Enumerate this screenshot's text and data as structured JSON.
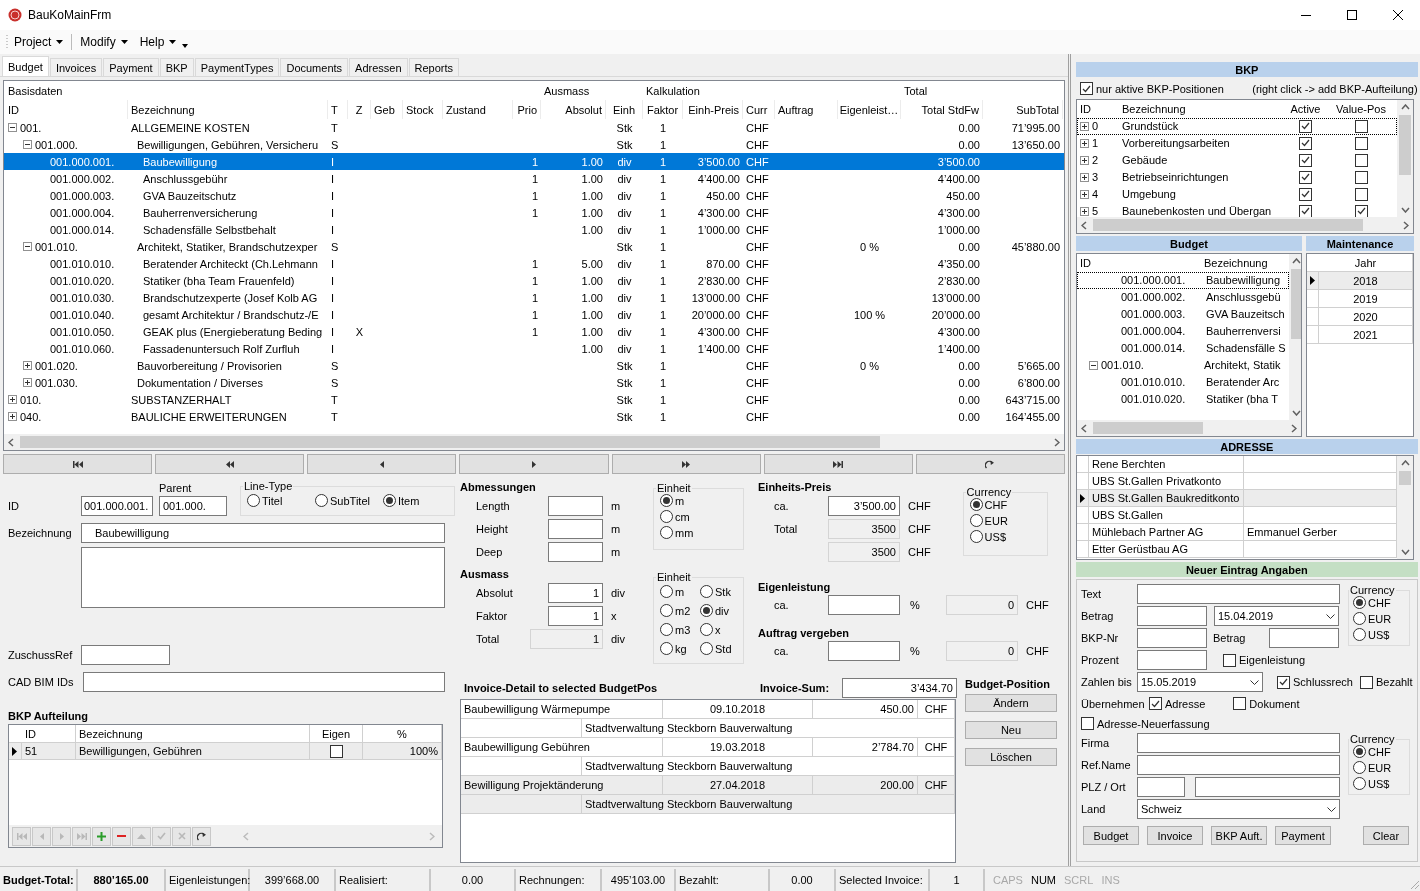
{
  "window": {
    "title": "BauKoMainFrm"
  },
  "menu": [
    {
      "label": "Project"
    },
    {
      "label": "Modify"
    },
    {
      "label": "Help"
    }
  ],
  "tabs": [
    {
      "label": "Budget",
      "selected": true
    },
    {
      "label": "Invoices",
      "selected": false
    },
    {
      "label": "Payment",
      "selected": false
    },
    {
      "label": "BKP",
      "selected": false
    },
    {
      "label": "PaymentTypes",
      "selected": false
    },
    {
      "label": "Documents",
      "selected": false
    },
    {
      "label": "Adressen",
      "selected": false
    },
    {
      "label": "Reports",
      "selected": false
    }
  ],
  "budget_grid": {
    "groups": [
      "Basisdaten",
      "Ausmass",
      "Kalkulation",
      "Total"
    ],
    "columns": [
      "ID",
      "Bezeichnung",
      "T",
      "Z",
      "Geb",
      "Stock",
      "Zustand",
      "Prio",
      "Absolut",
      "Einh",
      "Faktor",
      "Einh-Preis",
      "Curr",
      "Auftrag",
      "Eigenleist…",
      "Total StdFw",
      "SubTotal"
    ],
    "rows": [
      {
        "id": "001.",
        "bezeichnung": "ALLGEMEINE KOSTEN",
        "t": "T",
        "einh": "Stk",
        "faktor": "1",
        "curr": "CHF",
        "total_stdfw": "0.00",
        "subtotal": "71’995.00",
        "expanded": true,
        "selected": false,
        "children": [
          {
            "id": "001.000.",
            "bezeichnung": "Bewilligungen, Gebühren, Versicheru",
            "t": "S",
            "einh": "Stk",
            "faktor": "1",
            "curr": "CHF",
            "total_stdfw": "0.00",
            "subtotal": "13’650.00",
            "expanded": true,
            "selected": false,
            "children": [
              {
                "id": "001.000.001.",
                "bezeichnung": "Baubewilligung",
                "t": "I",
                "prio": "1",
                "absolut": "1.00",
                "einh": "div",
                "faktor": "1",
                "einh_preis": "3’500.00",
                "curr": "CHF",
                "total_stdfw": "3’500.00",
                "selected": true
              },
              {
                "id": "001.000.002.",
                "bezeichnung": "Anschlussgebühr",
                "t": "I",
                "prio": "1",
                "absolut": "1.00",
                "einh": "div",
                "faktor": "1",
                "einh_preis": "4’400.00",
                "curr": "CHF",
                "total_stdfw": "4’400.00",
                "selected": false
              },
              {
                "id": "001.000.003.",
                "bezeichnung": "GVA Bauzeitschutz",
                "t": "I",
                "prio": "1",
                "absolut": "1.00",
                "einh": "div",
                "faktor": "1",
                "einh_preis": "450.00",
                "curr": "CHF",
                "total_stdfw": "450.00",
                "selected": false
              },
              {
                "id": "001.000.004.",
                "bezeichnung": "Bauherrenversicherung",
                "t": "I",
                "prio": "1",
                "absolut": "1.00",
                "einh": "div",
                "faktor": "1",
                "einh_preis": "4’300.00",
                "curr": "CHF",
                "total_stdfw": "4’300.00",
                "selected": false
              },
              {
                "id": "001.000.014.",
                "bezeichnung": "Schadensfälle Selbstbehalt",
                "t": "I",
                "absolut": "1.00",
                "einh": "div",
                "faktor": "1",
                "einh_preis": "1’000.00",
                "curr": "CHF",
                "total_stdfw": "1’000.00",
                "selected": false
              }
            ]
          },
          {
            "id": "001.010.",
            "bezeichnung": "Architekt, Statiker, Brandschutzexper",
            "t": "S",
            "einh": "Stk",
            "faktor": "1",
            "curr": "CHF",
            "eigenleistung": "0 %",
            "total_stdfw": "0.00",
            "subtotal": "45’880.00",
            "expanded": true,
            "selected": false,
            "children": [
              {
                "id": "001.010.010.",
                "bezeichnung": "Beratender Architeckt (Ch.Lehmann",
                "t": "I",
                "prio": "1",
                "absolut": "5.00",
                "einh": "div",
                "faktor": "1",
                "einh_preis": "870.00",
                "curr": "CHF",
                "total_stdfw": "4’350.00",
                "selected": false
              },
              {
                "id": "001.010.020.",
                "bezeichnung": "Statiker (bha Team Frauenfeld)",
                "t": "I",
                "prio": "1",
                "absolut": "1.00",
                "einh": "div",
                "faktor": "1",
                "einh_preis": "2’830.00",
                "curr": "CHF",
                "total_stdfw": "2’830.00",
                "selected": false
              },
              {
                "id": "001.010.030.",
                "bezeichnung": "Brandschutzexperte (Josef Kolb AG",
                "t": "I",
                "prio": "1",
                "absolut": "1.00",
                "einh": "div",
                "faktor": "1",
                "einh_preis": "13’000.00",
                "curr": "CHF",
                "total_stdfw": "13’000.00",
                "selected": false
              },
              {
                "id": "001.010.040.",
                "bezeichnung": "gesamt Architektur / Brandschutz-/E",
                "t": "I",
                "prio": "1",
                "absolut": "1.00",
                "einh": "div",
                "faktor": "1",
                "einh_preis": "20’000.00",
                "curr": "CHF",
                "eigenleistung": "100 %",
                "total_stdfw": "20’000.00",
                "selected": false
              },
              {
                "id": "001.010.050.",
                "bezeichnung": "GEAK plus  (Energieberatung Beding",
                "t": "I",
                "z": "X",
                "prio": "1",
                "absolut": "1.00",
                "einh": "div",
                "faktor": "1",
                "einh_preis": "4’300.00",
                "curr": "CHF",
                "total_stdfw": "4’300.00",
                "selected": false
              },
              {
                "id": "001.010.060.",
                "bezeichnung": "Fassadenuntersuch Rolf Zurfluh",
                "t": "I",
                "absolut": "1.00",
                "einh": "div",
                "faktor": "1",
                "einh_preis": "1’400.00",
                "curr": "CHF",
                "total_stdfw": "1’400.00",
                "selected": false
              }
            ]
          },
          {
            "id": "001.020.",
            "bezeichnung": "Bauvorbereitung / Provisorien",
            "t": "S",
            "einh": "Stk",
            "faktor": "1",
            "curr": "CHF",
            "eigenleistung": "0 %",
            "total_stdfw": "0.00",
            "subtotal": "5’665.00",
            "expanded": false,
            "selected": false
          },
          {
            "id": "001.030.",
            "bezeichnung": "Dokumentation / Diverses",
            "t": "S",
            "einh": "Stk",
            "faktor": "1",
            "curr": "CHF",
            "total_stdfw": "0.00",
            "subtotal": "6’800.00",
            "expanded": false,
            "selected": false
          }
        ]
      },
      {
        "id": "010.",
        "bezeichnung": "SUBSTANZERHALT",
        "t": "T",
        "einh": "Stk",
        "faktor": "1",
        "curr": "CHF",
        "total_stdfw": "0.00",
        "subtotal": "643’715.00",
        "expanded": false,
        "selected": false
      },
      {
        "id": "040.",
        "bezeichnung": "BAULICHE ERWEITERUNGEN",
        "t": "T",
        "einh": "Stk",
        "faktor": "1",
        "curr": "CHF",
        "total_stdfw": "0.00",
        "subtotal": "164’455.00",
        "expanded": false,
        "selected": false
      }
    ]
  },
  "position_form": {
    "id": {
      "label": "ID",
      "value": "001.000.001."
    },
    "parent": {
      "label": "Parent",
      "value": "001.000."
    },
    "line_type": {
      "title": "Line-Type",
      "options": [
        {
          "label": "Titel",
          "selected": false
        },
        {
          "label": "SubTitel",
          "selected": false
        },
        {
          "label": "Item",
          "selected": true
        }
      ]
    },
    "bezeichnung": {
      "label": "Bezeichnung",
      "value": "Baubewilligung"
    },
    "zuschuss_ref": {
      "label": "ZuschussRef"
    },
    "cad_bim_ids": {
      "label": "CAD BIM IDs"
    },
    "bkp_aufteilung": {
      "title": "BKP Aufteilung",
      "columns": [
        "ID",
        "Bezeichnung",
        "Eigen",
        "%"
      ],
      "rows": [
        {
          "id": "51",
          "bezeichnung": "Bewilligungen, Gebühren",
          "eigen": false,
          "percent": "100%",
          "selected": true
        }
      ]
    }
  },
  "measures": {
    "abmessungen": {
      "title": "Abmessungen",
      "rows": [
        {
          "label": "Length",
          "unit": "m",
          "readonly": false
        },
        {
          "label": "Height",
          "unit": "m",
          "readonly": false
        },
        {
          "label": "Deep",
          "unit": "m",
          "readonly": false
        }
      ]
    },
    "einheit_1": {
      "title": "Einheit",
      "options": [
        {
          "label": "m",
          "selected": true
        },
        {
          "label": "cm",
          "selected": false
        },
        {
          "label": "mm",
          "selected": false
        }
      ]
    },
    "ausmass": {
      "title": "Ausmass",
      "rows": [
        {
          "label": "Absolut",
          "value": "1",
          "unit": "div",
          "readonly": false
        },
        {
          "label": "Faktor",
          "value": "1",
          "unit": "x",
          "readonly": false
        },
        {
          "label": "Total",
          "value": "1",
          "unit": "div",
          "readonly": true
        }
      ]
    },
    "einheit_2": {
      "title": "Einheit",
      "options": [
        {
          "label": "m",
          "selected": false
        },
        {
          "label": "Stk",
          "selected": false
        },
        {
          "label": "m2",
          "selected": false
        },
        {
          "label": "div",
          "selected": true
        },
        {
          "label": "m3",
          "selected": false
        },
        {
          "label": "x",
          "selected": false
        },
        {
          "label": "kg",
          "selected": false
        },
        {
          "label": "Std",
          "selected": false
        }
      ]
    },
    "einheits_preis": {
      "title": "Einheits-Preis",
      "rows": [
        {
          "label": "ca.",
          "value": "3’500.00",
          "unit": "CHF",
          "readonly": false
        },
        {
          "label": "Total",
          "value": "3500",
          "unit": "CHF",
          "readonly": true
        },
        {
          "value": "3500",
          "unit": "CHF",
          "readonly": true
        }
      ]
    },
    "currency": {
      "title": "Currency",
      "options": [
        {
          "label": "CHF",
          "selected": true
        },
        {
          "label": "EUR",
          "selected": false
        },
        {
          "label": "US$",
          "selected": false
        }
      ]
    },
    "shares": [
      {
        "title": "Eigenleistung",
        "label": "ca.",
        "unit": "%",
        "amount": "0",
        "currency": "CHF"
      },
      {
        "title": "Auftrag vergeben",
        "label": "ca.",
        "unit": "%",
        "amount": "0",
        "currency": "CHF"
      }
    ]
  },
  "invoice_detail": {
    "title": "Invoice-Detail to selected BudgetPos",
    "sum_label": "Invoice-Sum:",
    "sum": "3’434.70",
    "invoices": [
      {
        "text": "Baubewilligung Wärmepumpe",
        "date": "09.10.2018",
        "amount": "450.00",
        "currency": "CHF",
        "payee": "Stadtverwaltung Steckborn Bauverwaltung",
        "selected": false
      },
      {
        "text": "Baubewilligung Gebühren",
        "date": "19.03.2018",
        "amount": "2’784.70",
        "currency": "CHF",
        "payee": "Stadtverwaltung Steckborn Bauverwaltung",
        "selected": false
      },
      {
        "text": "Bewilligung Projektänderung",
        "date": "27.04.2018",
        "amount": "200.00",
        "currency": "CHF",
        "payee": "Stadtverwaltung Steckborn Bauverwaltung",
        "selected": true
      }
    ]
  },
  "budget_position": {
    "title": "Budget-Position",
    "buttons": [
      "Ändern",
      "Neu",
      "Löschen"
    ]
  },
  "right_panel": {
    "bkp": {
      "title": "BKP",
      "filter": {
        "label": "nur aktive BKP-Positionen",
        "checked": true
      },
      "hint": "(right click -> add BKP-Aufteilung)",
      "columns": [
        "ID",
        "Bezeichnung",
        "Active",
        "Value-Pos"
      ],
      "rows": [
        {
          "id": "0",
          "bezeichnung": "Grundstück",
          "active": true,
          "value_pos": false,
          "expanded": false,
          "selected": true
        },
        {
          "id": "1",
          "bezeichnung": "Vorbereitungsarbeiten",
          "active": true,
          "value_pos": false,
          "expanded": false,
          "selected": false
        },
        {
          "id": "2",
          "bezeichnung": "Gebäude",
          "active": true,
          "value_pos": false,
          "expanded": false,
          "selected": false
        },
        {
          "id": "3",
          "bezeichnung": "Betriebseinrichtungen",
          "active": true,
          "value_pos": false,
          "expanded": false,
          "selected": false
        },
        {
          "id": "4",
          "bezeichnung": "Umgebung",
          "active": true,
          "value_pos": false,
          "expanded": false,
          "selected": false
        },
        {
          "id": "5",
          "bezeichnung": "Baunebenkosten und Übergan",
          "active": true,
          "value_pos": true,
          "expanded": false,
          "selected": false
        }
      ]
    },
    "budget": {
      "title": "Budget",
      "columns": [
        "ID",
        "Bezeichnung"
      ],
      "rows": [
        {
          "expanded": true,
          "children": [
            {
              "id": "001.000.001.",
              "bezeichnung": "Baubewilligung",
              "selected": true
            },
            {
              "id": "001.000.002.",
              "bezeichnung": "Anschlussgebü",
              "selected": false
            },
            {
              "id": "001.000.003.",
              "bezeichnung": "GVA Bauzeitsch",
              "selected": false
            },
            {
              "id": "001.000.004.",
              "bezeichnung": "Bauherrenversi",
              "selected": false
            },
            {
              "id": "001.000.014.",
              "bezeichnung": "Schadensfälle S",
              "selected": false
            }
          ]
        },
        {
          "id": "001.010.",
          "bezeichnung": "Architekt, Statik",
          "expanded": true,
          "selected": false,
          "children": [
            {
              "id": "001.010.010.",
              "bezeichnung": "Beratender Arc",
              "selected": false
            },
            {
              "id": "001.010.020.",
              "bezeichnung": "Statiker (bha T",
              "selected": false
            }
          ]
        }
      ]
    },
    "maintenance": {
      "title": "Maintenance",
      "column": "Jahr",
      "rows": [
        {
          "year": "2018",
          "selected": true
        },
        {
          "year": "2019",
          "selected": false
        },
        {
          "year": "2020",
          "selected": false
        },
        {
          "year": "2021",
          "selected": false
        }
      ]
    },
    "adresse": {
      "title": "ADRESSE",
      "rows": [
        {
          "name": "Rene Berchten",
          "selected": false
        },
        {
          "name": "UBS St.Gallen Privatkonto",
          "selected": false
        },
        {
          "name": "UBS St.Gallen Baukreditkonto",
          "selected": true
        },
        {
          "name": "UBS St.Gallen",
          "selected": false
        },
        {
          "name": "Mühlebach Partner AG",
          "contact": "Emmanuel Gerber",
          "selected": false
        },
        {
          "name": "Etter Gerüstbau AG",
          "selected": false
        }
      ]
    },
    "new_entry": {
      "title": "Neuer Eintrag Angaben",
      "text": {
        "label": "Text"
      },
      "betrag": {
        "label": "Betrag",
        "date": "15.04.2019"
      },
      "bkp_nr": {
        "label": "BKP-Nr",
        "betrag_label": "Betrag"
      },
      "prozent": {
        "label": "Prozent"
      },
      "eigenleistung": {
        "label": "Eigenleistung",
        "checked": false
      },
      "currency": {
        "title": "Currency",
        "options": [
          {
            "label": "CHF",
            "selected": true
          },
          {
            "label": "EUR",
            "selected": false
          },
          {
            "label": "US$",
            "selected": false
          }
        ]
      },
      "zahlen_bis": {
        "label": "Zahlen bis",
        "date": "15.05.2019"
      },
      "schlussrech": {
        "label": "Schlussrech",
        "checked": true
      },
      "bezahlt": {
        "label": "Bezahlt",
        "checked": false
      },
      "uebernehmen": {
        "label": "Übernehmen"
      },
      "adresse": {
        "label": "Adresse",
        "checked": true
      },
      "dokument": {
        "label": "Dokument",
        "checked": false
      },
      "adresse_neuerfassung": {
        "label": "Adresse-Neuerfassung",
        "checked": false
      },
      "firma": {
        "label": "Firma"
      },
      "ref_name": {
        "label": "Ref.Name"
      },
      "plz_ort": {
        "label": "PLZ / Ort"
      },
      "land": {
        "label": "Land",
        "value": "Schweiz"
      },
      "address_currency": {
        "title": "Currency",
        "options": [
          {
            "label": "CHF",
            "selected": true
          },
          {
            "label": "EUR",
            "selected": false
          },
          {
            "label": "US$",
            "selected": false
          }
        ]
      },
      "buttons": [
        "Budget",
        "Invoice",
        "BKP Auft.",
        "Payment",
        "Clear"
      ]
    }
  },
  "status_bar": {
    "fields": [
      {
        "label": "Budget-Total:",
        "value": "880’165.00",
        "kind": "total"
      },
      {
        "label": "Eigenleistungen:",
        "value": "399’668.00",
        "kind": "plain"
      },
      {
        "label": "Realisiert:",
        "value": "0.00",
        "kind": "plain"
      },
      {
        "label": "Rechnungen:",
        "value": "495’103.00",
        "kind": "plain"
      },
      {
        "label": "Bezahlt:",
        "value": "0.00",
        "kind": "plain"
      },
      {
        "label": "Selected Invoice:",
        "value": "1",
        "kind": "plain"
      }
    ],
    "indicators": [
      {
        "label": "CAPS",
        "on": false
      },
      {
        "label": "NUM",
        "on": true
      },
      {
        "label": "SCRL",
        "on": false
      },
      {
        "label": "INS",
        "on": false
      }
    ]
  }
}
